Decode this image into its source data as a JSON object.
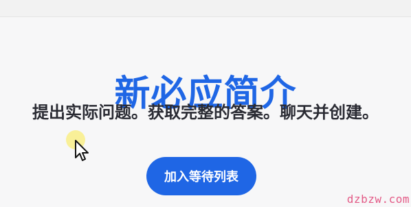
{
  "hero": {
    "title": "新必应简介",
    "subtitle": "提出实际问题。获取完整的答案。聊天并创建。"
  },
  "cta": {
    "label": "加入等待列表"
  },
  "watermark": {
    "text": "dzbzw.com"
  },
  "colors": {
    "accent": "#1f66e5",
    "title": "#1f66e5",
    "subtitle": "#2a2b33",
    "background": "#f7f7f8",
    "button_text": "#ffffff",
    "watermark": "#e35a86",
    "cursor_halo": "#faee78"
  },
  "icons": {
    "cursor": "mouse-pointer-icon"
  }
}
